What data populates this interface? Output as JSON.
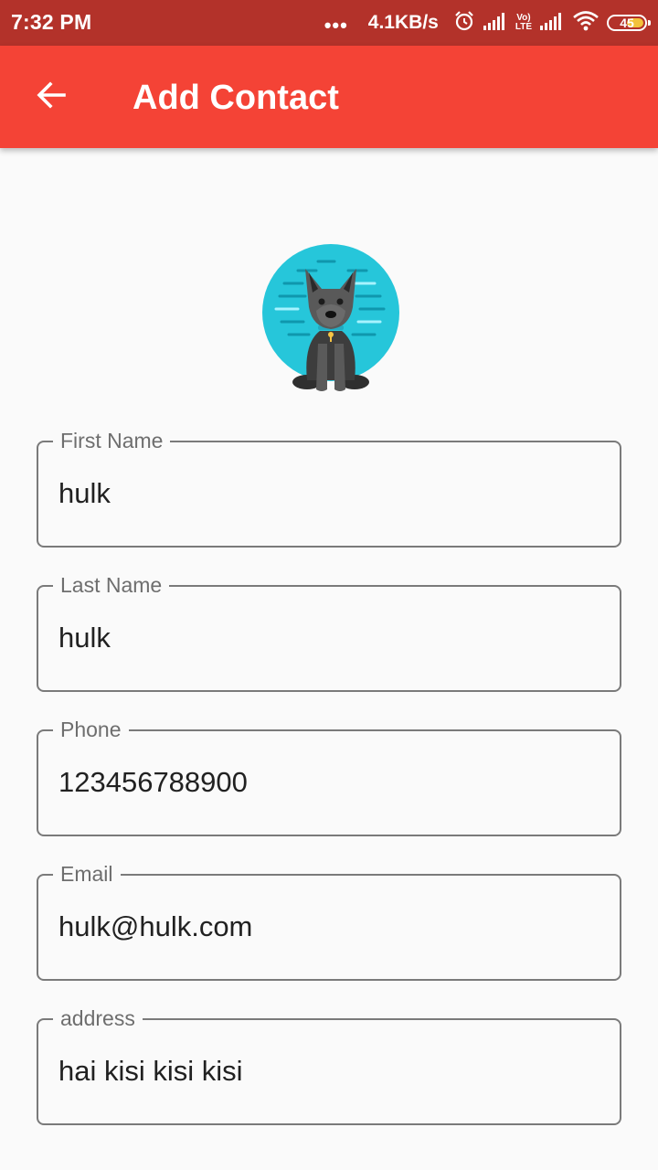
{
  "status_bar": {
    "time": "7:32 PM",
    "dots": "•••",
    "speed": "4.1KB/s",
    "lte_top": "Vo)",
    "lte_bottom": "LTE",
    "battery": "45",
    "icons": [
      "alarm-icon",
      "signal-icon",
      "volte-icon",
      "signal-icon",
      "wifi-icon",
      "battery-icon"
    ]
  },
  "app_bar": {
    "title": "Add Contact",
    "back_icon": "arrow-back-icon",
    "color": "#f44336"
  },
  "avatar": {
    "icon": "dog-avatar-icon",
    "color": "#26c6da"
  },
  "form": {
    "first_name": {
      "label": "First Name",
      "value": "hulk"
    },
    "last_name": {
      "label": "Last Name",
      "value": "hulk"
    },
    "phone": {
      "label": "Phone",
      "value": "123456788900"
    },
    "email": {
      "label": "Email",
      "value": "hulk@hulk.com"
    },
    "address": {
      "label": "address",
      "value": "hai kisi kisi kisi"
    }
  }
}
